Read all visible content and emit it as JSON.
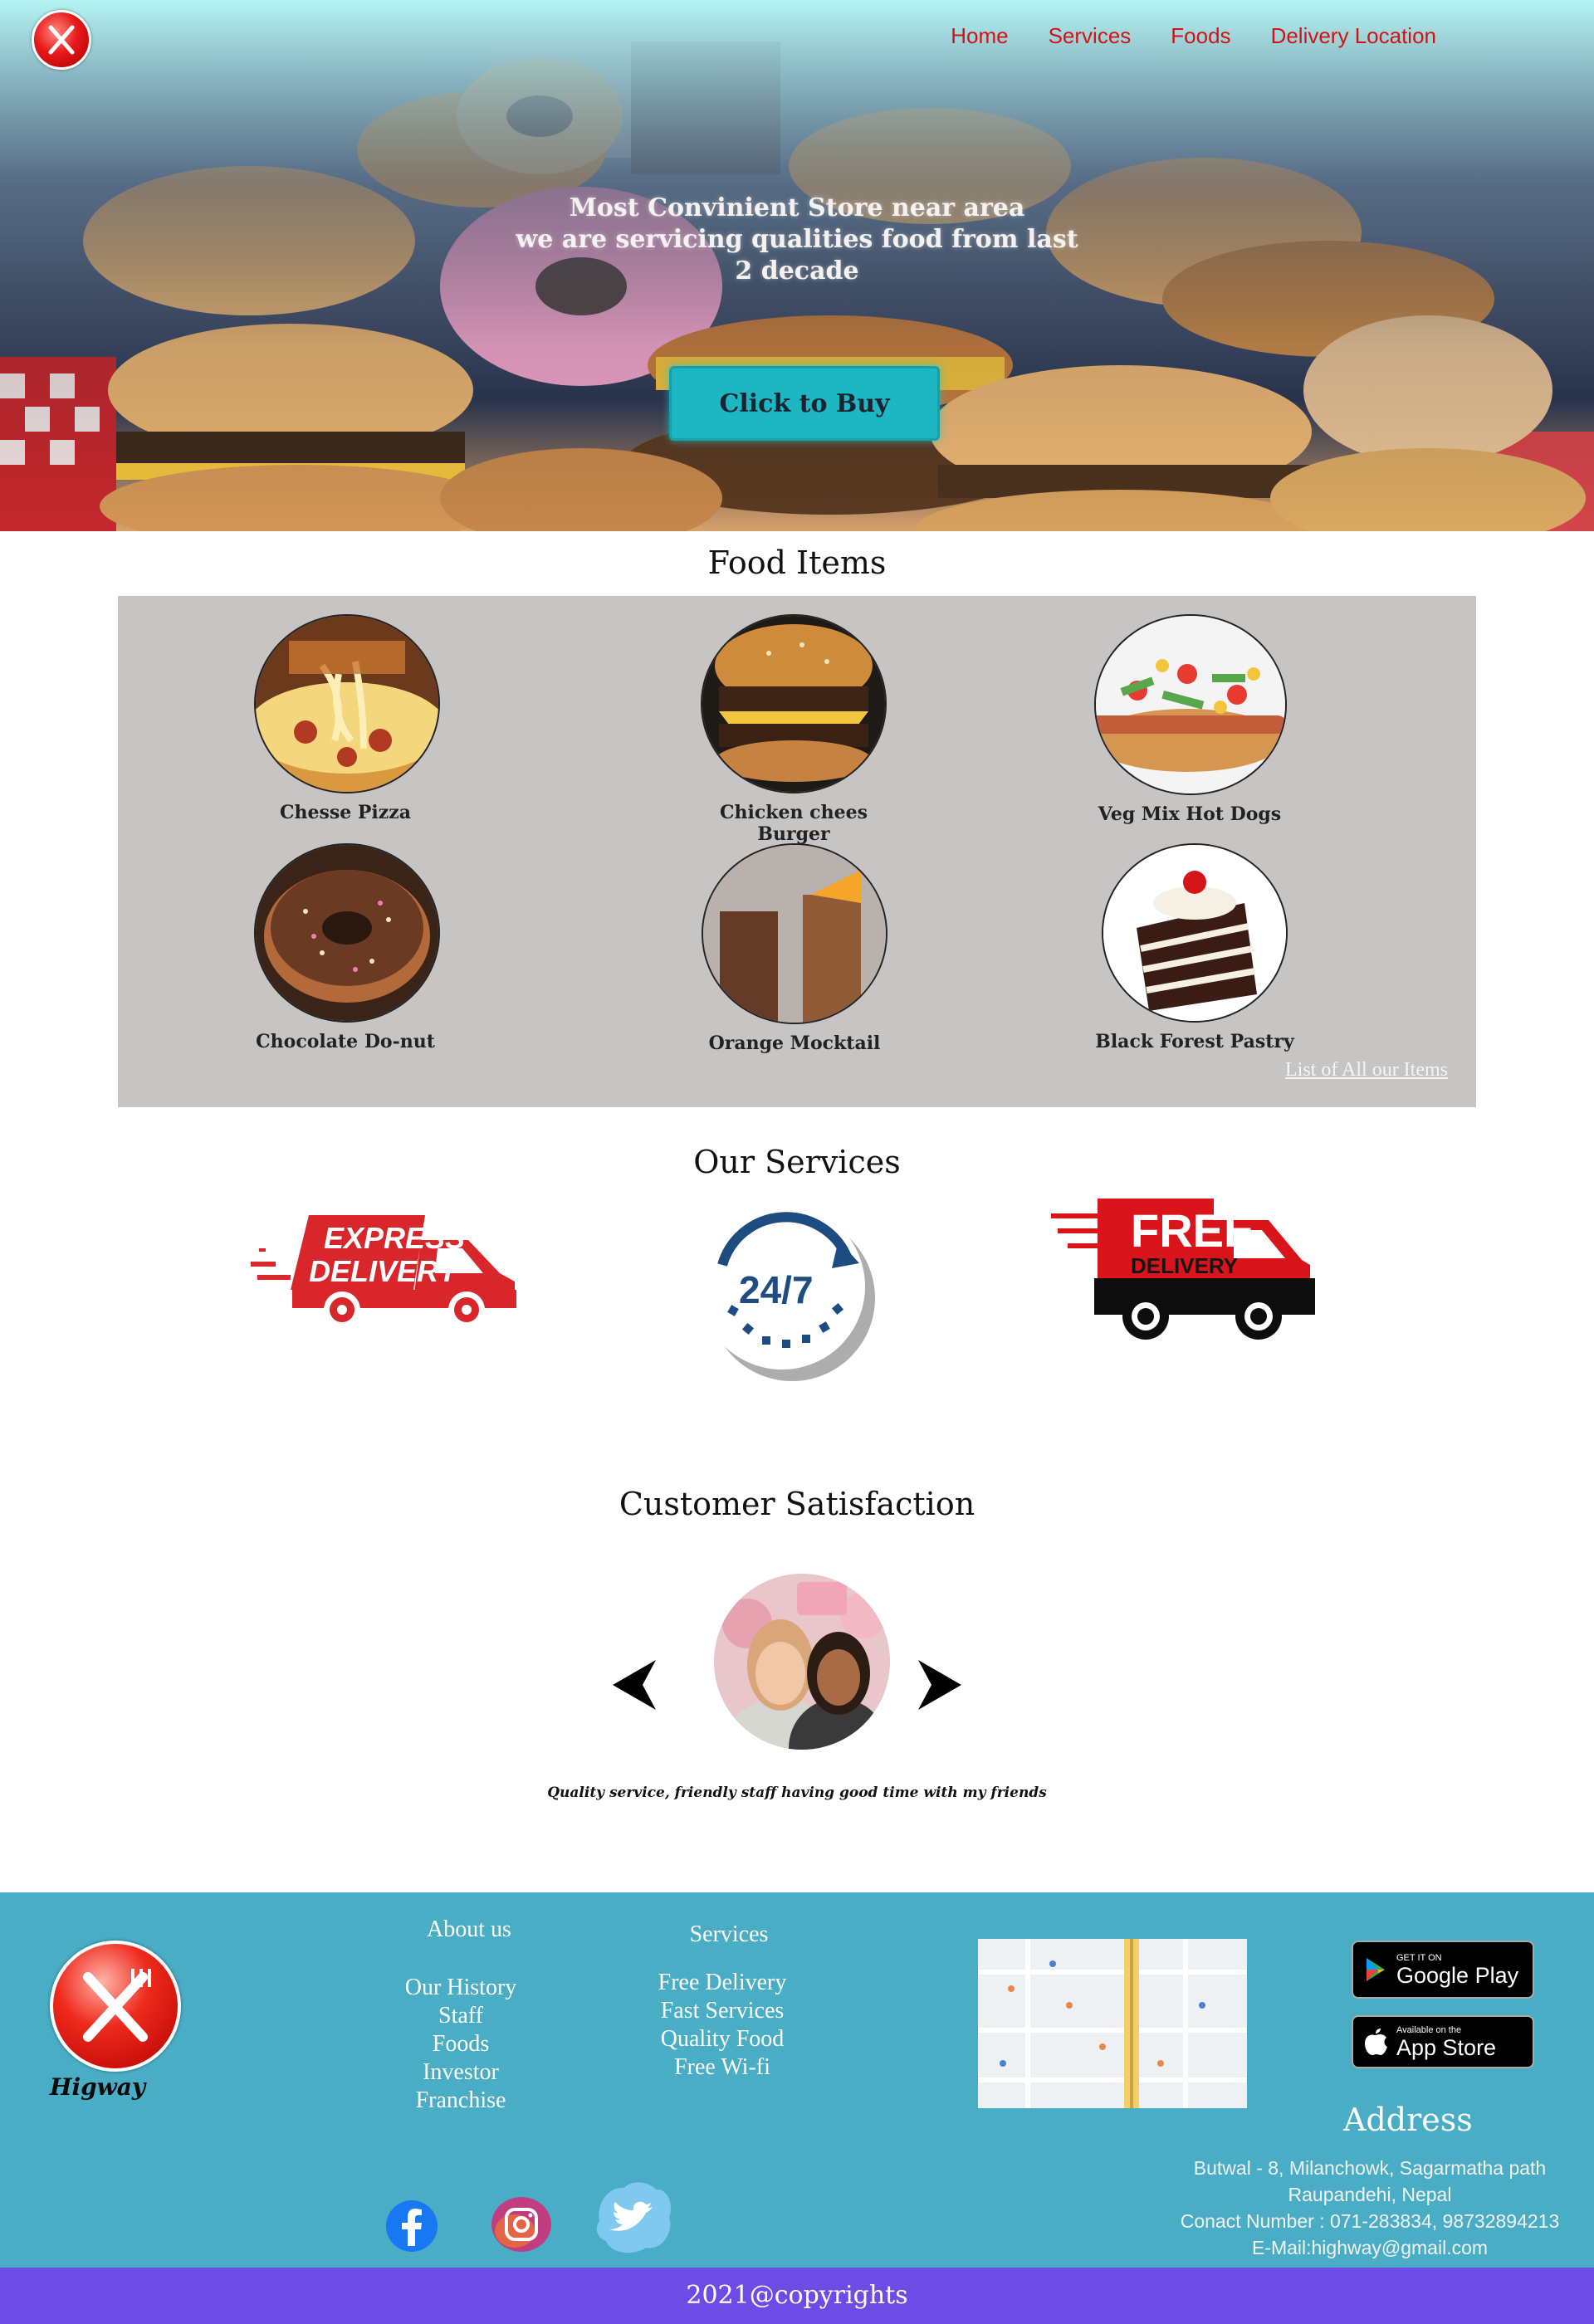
{
  "nav": {
    "items": [
      "Home",
      "Services",
      "Foods",
      "Delivery Location"
    ]
  },
  "hero": {
    "line1": "Most Convinient Store near area",
    "line2": "we are servicing qualities food from last",
    "line3": "2 decade",
    "cta": "Click to Buy"
  },
  "food": {
    "title": "Food Items",
    "items": [
      {
        "label": "Chesse Pizza"
      },
      {
        "label": "Chicken chees Burger"
      },
      {
        "label": "Veg Mix Hot Dogs"
      },
      {
        "label": "Chocolate Do-nut"
      },
      {
        "label": "Orange Mocktail"
      },
      {
        "label": "Black Forest Pastry"
      }
    ],
    "list_link": "List of All our Items"
  },
  "services": {
    "title": "Our Services",
    "express_top": "EXPRESS",
    "express_bottom": "DELIVERY",
    "clock": "24/7",
    "free_top": "FREE",
    "free_bottom": "DELIVERY"
  },
  "satisfaction": {
    "title": "Customer Satisfaction",
    "review": "Quality service, friendly staff having good time with my friends"
  },
  "footer": {
    "brand": "Higway",
    "about": {
      "heading": "About us",
      "links": [
        "Our History",
        "Staff",
        "Foods",
        "Investor",
        "Franchise"
      ]
    },
    "services": {
      "heading": "Services",
      "links": [
        "Free Delivery",
        "Fast Services",
        "Quality Food",
        "Free Wi-fi"
      ]
    },
    "google_play": {
      "small": "GET IT ON",
      "big": "Google Play"
    },
    "app_store": {
      "small": "Available on the",
      "big": "App Store"
    },
    "address_title": "Address",
    "address_lines": [
      "Butwal - 8, Milanchowk, Sagarmatha path",
      "Raupandehi, Nepal",
      "Conact Number : 071-283834, 98732894213",
      "E-Mail:highway@gmail.com"
    ],
    "copyright": "2021@copyrights"
  },
  "colors": {
    "nav": "#d31313",
    "cta": "#1db7c4",
    "food_box": "#c7c4c4",
    "footer": "#4aadc6",
    "copyright_bar": "#6d4ce6"
  }
}
